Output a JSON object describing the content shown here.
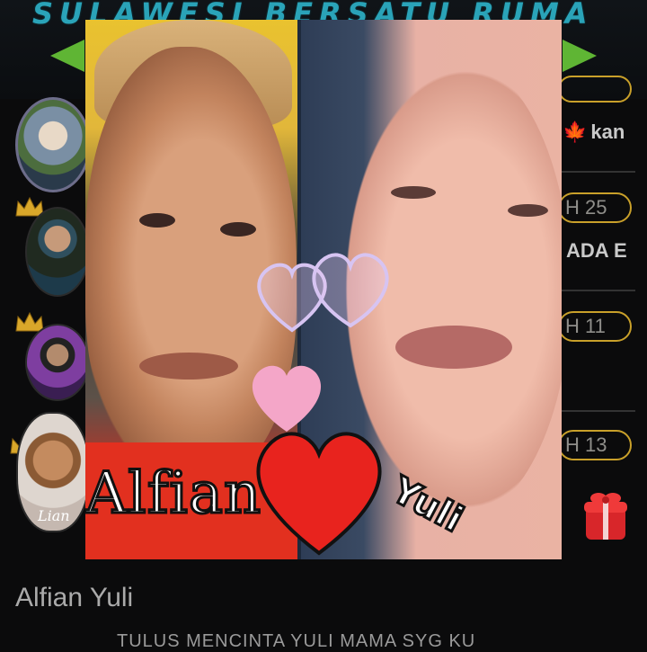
{
  "banner": {
    "title": "SULAWESI BERSATU RUMA"
  },
  "list": {
    "right_items": [
      {
        "text": "kan"
      },
      {
        "pill": "H 25"
      },
      {
        "text": "ADA E"
      },
      {
        "pill": "H 11"
      },
      {
        "pill": "H 13"
      }
    ],
    "avatar_label": "Lian"
  },
  "photo": {
    "left_name": "Alfian",
    "right_name": "Yuli"
  },
  "post": {
    "title": "Alfian Yuli",
    "description": "TULUS MENCINTA YULI MAMA SYG KU"
  },
  "colors": {
    "banner_text": "#2aa3b8",
    "arrow": "#5fb534",
    "pill_border": "#c9a02a",
    "heart": "#e8231e"
  }
}
